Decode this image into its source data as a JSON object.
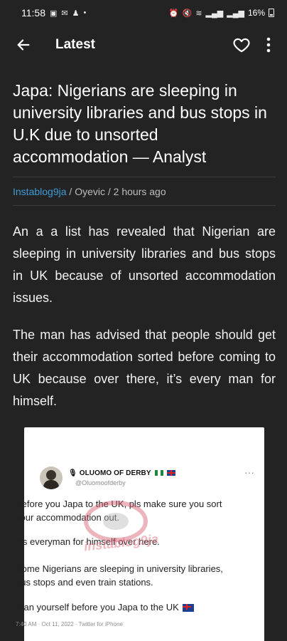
{
  "status_bar": {
    "time": "11:58",
    "battery": "16%"
  },
  "app_bar": {
    "title": "Latest"
  },
  "article": {
    "headline": "Japa: Nigerians are sleeping in university libraries and bus stops in U.K due to unsorted accommodation — Analyst",
    "source": "Instablog9ja",
    "author": "Oyevic",
    "time_ago": "2 hours ago",
    "paragraphs": [
      "An a a list has revealed that Nigerian are sleeping in university libraries and bus stops in UK because of unsorted accommodation issues.",
      "The man has advised that people should get their accommodation sorted before coming to UK because over there, it’s every man for himself."
    ]
  },
  "tweet": {
    "name": "OLUOMO OF DERBY",
    "handle": "@Oluomoofderby",
    "lines": [
      "Before you Japa to the UK, pls make sure you sort your accommodation out.",
      "It’s everyman for himself over here.",
      "Some Nigerians are sleeping in university libraries, bus stops and even train stations.",
      "Plan yourself before you Japa to the UK"
    ],
    "meta": "7:40 AM · Oct 11, 2022 · Twitter for iPhone",
    "watermark": "instablog9ja"
  },
  "icons": {
    "back": "arrow-left-icon",
    "favorite": "heart-outline-icon",
    "more": "more-vertical-icon"
  },
  "colors": {
    "background": "#232323",
    "source_link": "#3f9bd6"
  }
}
